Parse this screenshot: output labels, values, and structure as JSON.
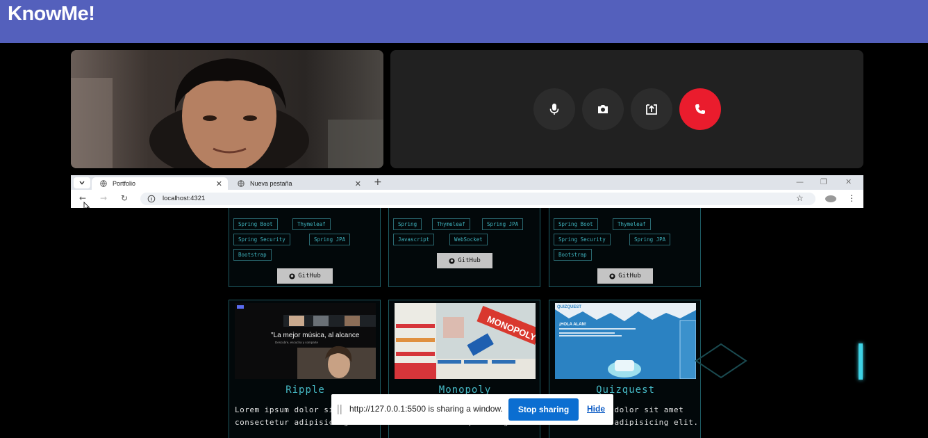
{
  "header": {
    "title": "KnowMe!"
  },
  "call_controls": {
    "icons": [
      "microphone-icon",
      "camera-icon",
      "screen-share-icon",
      "phone-hangup-icon"
    ],
    "hangup_color": "#ea1c2d"
  },
  "browser": {
    "tabs": [
      {
        "label": "Portfolio",
        "active": true
      },
      {
        "label": "Nueva pestaña",
        "active": false
      }
    ],
    "url": "localhost:4321"
  },
  "portfolio": {
    "top_cards": [
      {
        "tags": [
          "Spring Boot",
          "Thymeleaf",
          "Spring Security",
          "Spring JPA",
          "Bootstrap"
        ],
        "button": "GitHub"
      },
      {
        "tags": [
          "Spring",
          "Thymeleaf",
          "Spring JPA",
          "Javascript",
          "WebSocket"
        ],
        "button": "GitHub"
      },
      {
        "tags": [
          "Spring Boot",
          "Thymeleaf",
          "Spring Security",
          "Spring JPA",
          "Bootstrap"
        ],
        "button": "GitHub"
      }
    ],
    "bottom_cards": [
      {
        "title": "Ripple",
        "desc": "Lorem ipsum dolor sit amet consectetur adipisicing elit.",
        "thumb_headline": "\"La mejor música, al alcance",
        "thumb_sub": "Descubre, escucha y comparte"
      },
      {
        "title": "Monopoly",
        "desc": "Lorem ipsum dolor sit amet consectetur adipisicing elit.",
        "thumb_headline": "MONOPOLY"
      },
      {
        "title": "Quizquest",
        "desc": "Lorem ipsum dolor sit amet consectetur adipisicing elit.",
        "thumb_brand": "QUIZQUEST",
        "thumb_headline": "¡HOLA ALAN!"
      }
    ]
  },
  "share_bar": {
    "message": "http://127.0.0.1:5500 is sharing a window.",
    "stop_label": "Stop sharing",
    "hide_label": "Hide"
  },
  "colors": {
    "header_bg": "#5460bc",
    "accent_cyan": "#46bac6",
    "share_button": "#0b6ed1"
  }
}
